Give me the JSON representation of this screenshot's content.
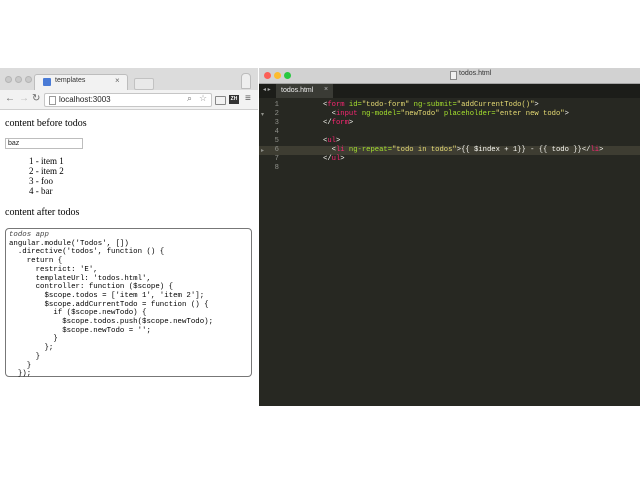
{
  "browser": {
    "tab_title": "templates",
    "tab_close": "×",
    "url": "localhost:3003",
    "ext_label": "ZH",
    "page": {
      "before_text": "content before todos",
      "input_value": "baz",
      "todos": [
        "1 - item 1",
        "2 - item 2",
        "3 - foo",
        "4 - bar"
      ],
      "after_text": "content after todos",
      "code_comment": "todos app",
      "code_lines": [
        "angular.module('Todos', [])",
        "  .directive('todos', function () {",
        "    return {",
        "      restrict: 'E',",
        "      templateUrl: 'todos.html',",
        "      controller: function ($scope) {",
        "        $scope.todos = ['item 1', 'item 2'];",
        "        $scope.addCurrentTodo = function () {",
        "          if ($scope.newTodo) {",
        "            $scope.todos.push($scope.newTodo);",
        "            $scope.newTodo = '';",
        "          }",
        "        };",
        "      }",
        "    }",
        "  });"
      ]
    }
  },
  "editor": {
    "window_title": "todos.html",
    "tab_label": "todos.html",
    "tab_close": "×",
    "tab_nav": "◂ ▸",
    "line_numbers": [
      "1",
      "2",
      "3",
      "4",
      "5",
      "6",
      "7",
      "8"
    ],
    "fold_markers": [
      "▾",
      "▸"
    ],
    "lines": [
      [
        "<",
        "form",
        " id=",
        "\"todo-form\"",
        " ng-submit=",
        "\"addCurrentTodo()\"",
        ">"
      ],
      [
        "  <",
        "input",
        " ng-model=",
        "\"newTodo\"",
        " placeholder=",
        "\"enter new todo\"",
        ">"
      ],
      [
        "</",
        "form",
        ">",
        "",
        "",
        "",
        ""
      ],
      [
        "",
        "",
        "",
        "",
        "",
        "",
        ""
      ],
      [
        "<",
        "ul",
        ">",
        "",
        "",
        "",
        ""
      ],
      [
        "  <",
        "li",
        " ng-repeat=",
        "\"todo in todos\"",
        ">{{ $index + 1}} - {{ todo }}</",
        "li",
        ">"
      ],
      [
        "</",
        "ul",
        ">",
        "",
        "",
        "",
        ""
      ],
      [
        "",
        "",
        "",
        "",
        "",
        "",
        ""
      ]
    ]
  }
}
